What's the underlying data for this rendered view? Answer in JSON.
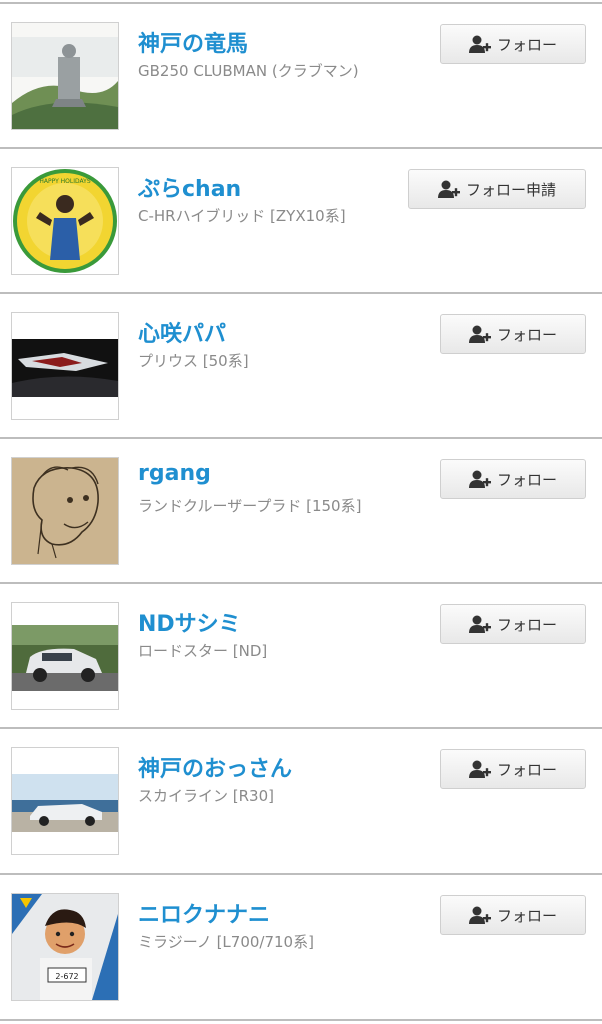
{
  "users": [
    {
      "name": "神戸の竜馬",
      "car": "GB250 CLUBMAN (クラブマン)",
      "button": "フォロー"
    },
    {
      "name": "ぷらchan",
      "car": "C-HRハイブリッド [ZYX10系]",
      "button": "フォロー申請"
    },
    {
      "name": "心咲パパ",
      "car": "プリウス [50系]",
      "button": "フォロー"
    },
    {
      "name": "rgang",
      "car": "ランドクルーザープラド [150系]",
      "button": "フォロー"
    },
    {
      "name": "NDサシミ",
      "car": "ロードスター [ND]",
      "button": "フォロー"
    },
    {
      "name": "神戸のおっさん",
      "car": "スカイライン [R30]",
      "button": "フォロー"
    },
    {
      "name": "ニロクナナニ",
      "car": "ミラジーノ [L700/710系]",
      "button": "フォロー"
    }
  ],
  "avatar_badges": {
    "happy_holidays": "HAPPY HOLIDAYS",
    "plate": "2-672"
  },
  "icons": {
    "follow": "add-user-icon"
  },
  "colors": {
    "username": "#1f8fd0",
    "subtitle": "#8a8a8a",
    "separator": "#bdbdbd"
  }
}
